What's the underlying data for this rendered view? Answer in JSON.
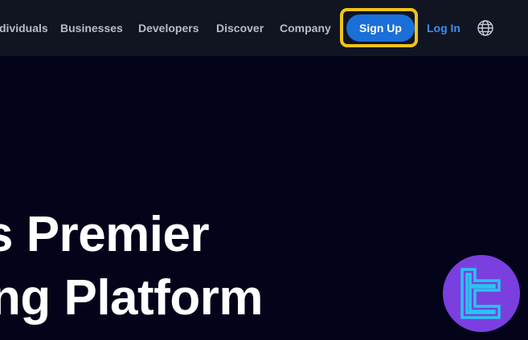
{
  "nav": {
    "items": [
      {
        "label": "dividuals"
      },
      {
        "label": "Businesses"
      },
      {
        "label": "Developers"
      },
      {
        "label": "Discover"
      },
      {
        "label": "Company"
      }
    ],
    "signup_label": "Sign Up",
    "login_label": "Log In",
    "language_icon": "globe-icon"
  },
  "hero": {
    "line1": "s Premier",
    "line2": "ng Platform"
  },
  "badge": {
    "icon": "tc-logo-icon"
  },
  "colors": {
    "background": "#03031a",
    "navbar": "#111522",
    "nav_text": "#b7bcc6",
    "signup_button": "#1a6fd8",
    "login_link": "#3d8ef5",
    "highlight": "#f0c419",
    "badge": "#7b3fe0",
    "logo_stroke": "#26c6f0"
  }
}
